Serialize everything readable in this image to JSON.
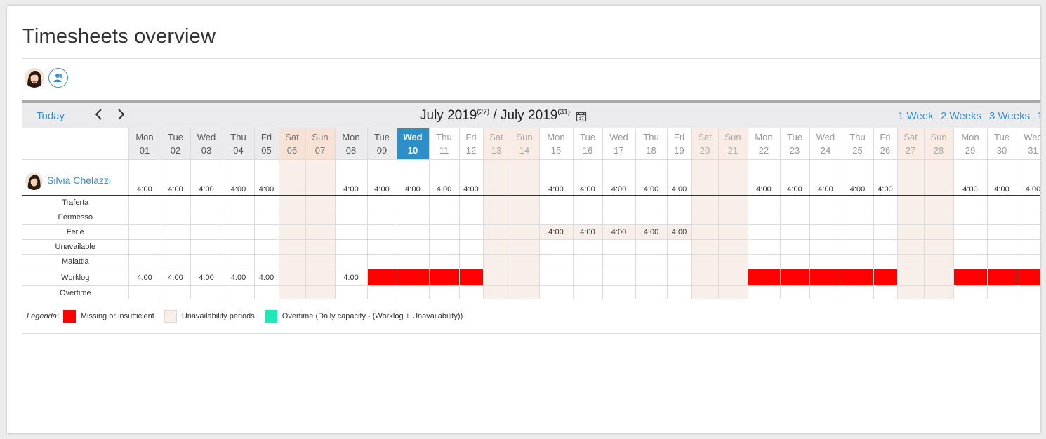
{
  "page": {
    "title": "Timesheets overview"
  },
  "toolbar": {
    "today_label": "Today",
    "prev_icon": "chevron-left-icon",
    "next_icon": "chevron-right-icon",
    "range_start": "July 2019",
    "range_start_week": "(27)",
    "range_sep": " / ",
    "range_end": "July 2019",
    "range_end_week": "(31)",
    "calendar_icon": "calendar-icon",
    "calendar_icon_day": "17",
    "views": [
      "1 Week",
      "2 Weeks",
      "3 Weeks",
      "1"
    ]
  },
  "days": [
    {
      "dow": "Mon",
      "num": "01",
      "kind": "past"
    },
    {
      "dow": "Tue",
      "num": "02",
      "kind": "past"
    },
    {
      "dow": "Wed",
      "num": "03",
      "kind": "past"
    },
    {
      "dow": "Thu",
      "num": "04",
      "kind": "past"
    },
    {
      "dow": "Fri",
      "num": "05",
      "kind": "past"
    },
    {
      "dow": "Sat",
      "num": "06",
      "kind": "past-we"
    },
    {
      "dow": "Sun",
      "num": "07",
      "kind": "past-we"
    },
    {
      "dow": "Mon",
      "num": "08",
      "kind": "past"
    },
    {
      "dow": "Tue",
      "num": "09",
      "kind": "past"
    },
    {
      "dow": "Wed",
      "num": "10",
      "kind": "today"
    },
    {
      "dow": "Thu",
      "num": "11",
      "kind": "fut"
    },
    {
      "dow": "Fri",
      "num": "12",
      "kind": "fut"
    },
    {
      "dow": "Sat",
      "num": "13",
      "kind": "fut-we"
    },
    {
      "dow": "Sun",
      "num": "14",
      "kind": "fut-we"
    },
    {
      "dow": "Mon",
      "num": "15",
      "kind": "fut"
    },
    {
      "dow": "Tue",
      "num": "16",
      "kind": "fut"
    },
    {
      "dow": "Wed",
      "num": "17",
      "kind": "fut"
    },
    {
      "dow": "Thu",
      "num": "18",
      "kind": "fut"
    },
    {
      "dow": "Fri",
      "num": "19",
      "kind": "fut"
    },
    {
      "dow": "Sat",
      "num": "20",
      "kind": "fut-we"
    },
    {
      "dow": "Sun",
      "num": "21",
      "kind": "fut-we"
    },
    {
      "dow": "Mon",
      "num": "22",
      "kind": "fut"
    },
    {
      "dow": "Tue",
      "num": "23",
      "kind": "fut"
    },
    {
      "dow": "Wed",
      "num": "24",
      "kind": "fut"
    },
    {
      "dow": "Thu",
      "num": "25",
      "kind": "fut"
    },
    {
      "dow": "Fri",
      "num": "26",
      "kind": "fut"
    },
    {
      "dow": "Sat",
      "num": "27",
      "kind": "fut-we"
    },
    {
      "dow": "Sun",
      "num": "28",
      "kind": "fut-we"
    },
    {
      "dow": "Mon",
      "num": "29",
      "kind": "fut"
    },
    {
      "dow": "Tue",
      "num": "30",
      "kind": "fut"
    },
    {
      "dow": "Wed",
      "num": "31",
      "kind": "fut"
    }
  ],
  "user": {
    "name": "Silvia Chelazzi",
    "capacity": [
      "4:00",
      "4:00",
      "4:00",
      "4:00",
      "4:00",
      "",
      "",
      "4:00",
      "4:00",
      "4:00",
      "4:00",
      "4:00",
      "",
      "",
      "4:00",
      "4:00",
      "4:00",
      "4:00",
      "4:00",
      "",
      "",
      "4:00",
      "4:00",
      "4:00",
      "4:00",
      "4:00",
      "",
      "",
      "4:00",
      "4:00",
      "4:00"
    ]
  },
  "rows": [
    {
      "label": "Traferta",
      "cells": []
    },
    {
      "label": "Permesso",
      "cells": []
    },
    {
      "label": "Ferie",
      "cells": {
        "14": "4:00",
        "15": "4:00",
        "16": "4:00",
        "17": "4:00",
        "18": "4:00"
      }
    },
    {
      "label": "Unavailable",
      "cells": []
    },
    {
      "label": "Malattia",
      "cells": []
    },
    {
      "label": "Worklog",
      "cells": {
        "0": "4:00",
        "1": "4:00",
        "2": "4:00",
        "3": "4:00",
        "4": "4:00",
        "7": "4:00"
      },
      "missing": [
        8,
        9,
        10,
        11,
        21,
        22,
        23,
        24,
        25,
        28,
        29,
        30
      ]
    },
    {
      "label": "Overtime",
      "cells": []
    }
  ],
  "legend": {
    "title": "Legenda:",
    "items": [
      {
        "label": "Missing or insufficient",
        "color": "#ff0000"
      },
      {
        "label": "Unavailability periods",
        "color": "#f8efea"
      },
      {
        "label": "Overtime (Daily capacity - (Worklog + Unavailability))",
        "color": "#1de9b6"
      }
    ]
  },
  "icons": {
    "avatar": "user-avatar-icon",
    "add_user": "add-user-icon"
  }
}
